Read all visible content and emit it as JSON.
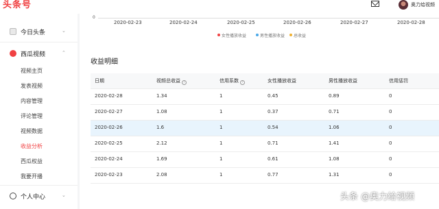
{
  "topbar": {
    "logo": "头条号",
    "user_name": "奥力给视频"
  },
  "sidebar": {
    "sections": [
      {
        "label": "今日头条",
        "icon": "toutiao-icon"
      },
      {
        "label": "西瓜视频",
        "icon": "xigua-icon"
      },
      {
        "label": "个人中心",
        "icon": "user-icon"
      }
    ],
    "items": [
      {
        "label": "视频主页"
      },
      {
        "label": "发表视频"
      },
      {
        "label": "内容管理"
      },
      {
        "label": "评论管理"
      },
      {
        "label": "视频数据"
      },
      {
        "label": "收益分析",
        "active": true
      },
      {
        "label": "西瓜权益"
      },
      {
        "label": "我要开播"
      }
    ]
  },
  "chart": {
    "y_zero": "0",
    "x_ticks": [
      "2020-02-23",
      "2020-02-24",
      "2020-02-25",
      "2020-02-26",
      "2020-02-27",
      "2020-02-28"
    ],
    "legend": [
      {
        "label": "女性播放收益",
        "color": "#f04142"
      },
      {
        "label": "男性播放收益",
        "color": "#4aa8e8"
      },
      {
        "label": "总收益",
        "color": "#f0b030"
      }
    ]
  },
  "details": {
    "title": "收益明细",
    "columns": [
      "日期",
      "视频总收益",
      "信用系数",
      "女性播放收益",
      "男性播放收益",
      "信用惩罚"
    ],
    "rows": [
      [
        "2020-02-28",
        "1.34",
        "1",
        "0.45",
        "0.89",
        "0"
      ],
      [
        "2020-02-27",
        "1.08",
        "1",
        "0.37",
        "0.71",
        "0"
      ],
      [
        "2020-02-26",
        "1.6",
        "1",
        "0.54",
        "1.06",
        "0"
      ],
      [
        "2020-02-25",
        "2.12",
        "1",
        "0.71",
        "1.41",
        "0"
      ],
      [
        "2020-02-24",
        "1.69",
        "1",
        "0.61",
        "1.08",
        "0"
      ],
      [
        "2020-02-23",
        "2.08",
        "1",
        "0.77",
        "1.31",
        "0"
      ]
    ],
    "highlighted_row": 2
  },
  "watermark": "头条 @奥力给视频",
  "colors": {
    "brand": "#f04142",
    "highlight_row": "#e8f4fd"
  }
}
